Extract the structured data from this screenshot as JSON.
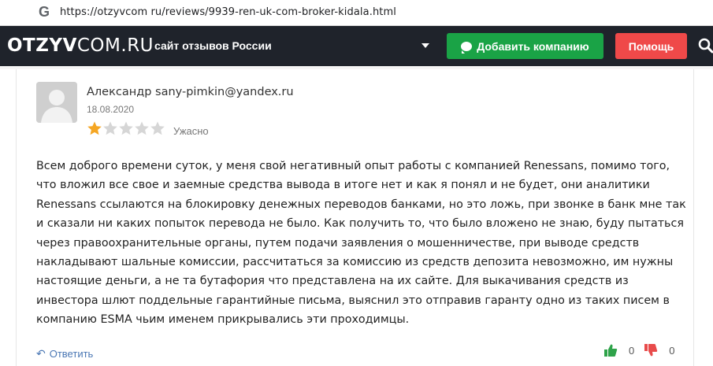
{
  "browser": {
    "favicon": "G",
    "url": "https://otzyvcom ru/reviews/9939-ren-uk-com-broker-kidala.html"
  },
  "header": {
    "logo_bold": "OTZYV",
    "logo_rest": "COM.RU",
    "tagline": "сайт отзывов России",
    "add_company_label": "Добавить компанию",
    "help_label": "Помощь",
    "colors": {
      "bar": "#1f232b",
      "add": "#1aa346",
      "help": "#ef4949"
    }
  },
  "review": {
    "author": "Александр sany-pimkin@yandex.ru",
    "date": "18.08.2020",
    "rating": 1,
    "rating_max": 5,
    "rating_label": "Ужасно",
    "text": "Всем доброго времени суток, у меня свой негативный опыт работы с компанией Renessans, помимо того, что вложил все свое и заемные средства вывода в итоге нет и как я понял и не будет, они аналитики Renessans ссылаются на блокировку денежных переводов банками, но это ложь, при звонке в банк мне так и сказали ни каких попыток перевода не было. Как получить то, что было вложено не знаю, буду пытаться через правоохранительные органы, путем подачи заявления о мошенничестве, при выводе средств накладывают шальные комиссии, рассчитаться за комиссию из средств депозита невозможно, им нужны настоящие деньги, а не та бутафория что представлена на их сайте. Для выкачивания средств из инвестора шлют поддельные гарантийные письма, выяснил это отправив гаранту одно из таких писем в компанию ESMA чьим именем прикрывались эти проходимцы.",
    "reply_label": "Ответить",
    "likes": "0",
    "dislikes": "0"
  }
}
